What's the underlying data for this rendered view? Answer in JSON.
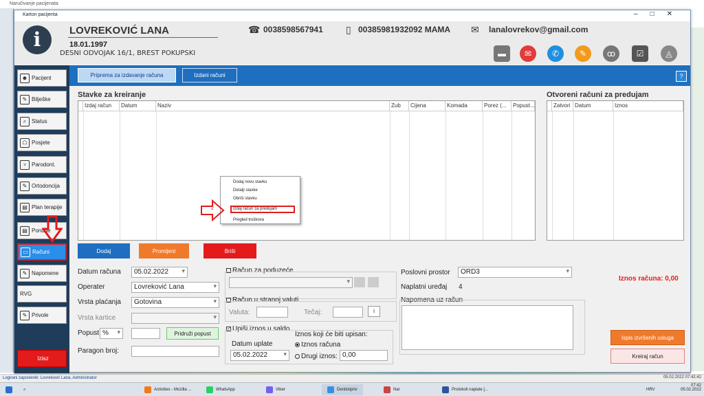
{
  "outer_title": "Naručivanje pacijenata",
  "status_bar": {
    "user": "Logirani zaposlenik: Lovreković Lana, Administrator",
    "datetime": "05.02.2022 07:42:42"
  },
  "window": {
    "title": "Karton pacijenta",
    "controls": [
      "–",
      "□",
      "✕"
    ]
  },
  "patient": {
    "name": "LOVREKOVIĆ LANA",
    "dob": "18.01.1997",
    "address": "DESNI ODVOJAK 16/1, BREST POKUPSKI",
    "phone": "0038598567941",
    "mobile": "00385981932092 MAMA",
    "email": "lanalovrekov@gmail.com"
  },
  "sidebar": {
    "items": [
      "Pacijent",
      "Bilješke",
      "Status",
      "Posjete",
      "Parodont.",
      "Ortodoncija",
      "Plan terapije",
      "Ponude",
      "Računi",
      "Napomene",
      "RVG",
      "Privole"
    ],
    "exit": "Izlaz"
  },
  "tabs": [
    "Priprema za izdavanje računa",
    "Izdani računi"
  ],
  "help": "?",
  "stavke": {
    "title": "Stavke za kreiranje",
    "columns": [
      "Izdaj račun",
      "Datum",
      "Naziv",
      "Zub",
      "Cijena",
      "Komada",
      "Porez (...",
      "Popust..."
    ]
  },
  "otvoreni": {
    "title": "Otvoreni računi za predujam",
    "columns": [
      "Zatvori",
      "Datum",
      "Iznos"
    ]
  },
  "context_menu": {
    "items": [
      "Dodaj novu stavku",
      "Detalji stavke",
      "Obriši stavku",
      "Izdaj račun za predujam",
      "Pregled troškova"
    ],
    "step": "2"
  },
  "buttons": {
    "dodaj": "Dodaj",
    "promijeni": "Promijeni",
    "brisi": "Briši",
    "pridruzi": "Pridruži popust",
    "ispis": "Ispis izvršenih usluga",
    "kreiraj": "Kreiraj račun",
    "valuta_btn": "i"
  },
  "form": {
    "datum_racuna_label": "Datum računa",
    "datum_racuna": "05.02.2022",
    "operater_label": "Operater",
    "operater": "Lovreković Lana",
    "vrsta_placanja_label": "Vrsta plaćanja",
    "vrsta_placanja": "Gotovina",
    "vrsta_kartice_label": "Vrsta kartice",
    "popust_label": "Popust",
    "popust_unit": "%",
    "paragon_label": "Paragon broj:",
    "racun_poduzece": "Račun za poduzeće",
    "racun_strana": "Račun u stranoj valuti",
    "valuta_label": "Valuta:",
    "tecaj_label": "Tečaj:",
    "upisi_saldo": "Upiši iznos u saldo",
    "datum_uplate_label": "Datum uplate",
    "datum_uplate": "05.02.2022",
    "iznos_upisan_label": "Iznos koji će biti upisan:",
    "opt_iznos": "Iznos računa",
    "opt_drugi": "Drugi iznos:",
    "drugi_iznos": "0,00",
    "poslovni_label": "Poslovni prostor",
    "poslovni": "ORD3",
    "naplatni_label": "Naplatni uređaj",
    "naplatni": "4",
    "napomena_label": "Napomena uz račun",
    "iznos_racuna": "Iznos računa: 0,00"
  },
  "taskbar": {
    "items": [
      "Activities - Mozilla ...",
      "WhatsApp",
      "Viber",
      "Dentistipriv",
      "Nar",
      "Protokoli naplate [..."
    ],
    "lang": "HRV",
    "time": "07:42",
    "date": "05.02.2022"
  }
}
